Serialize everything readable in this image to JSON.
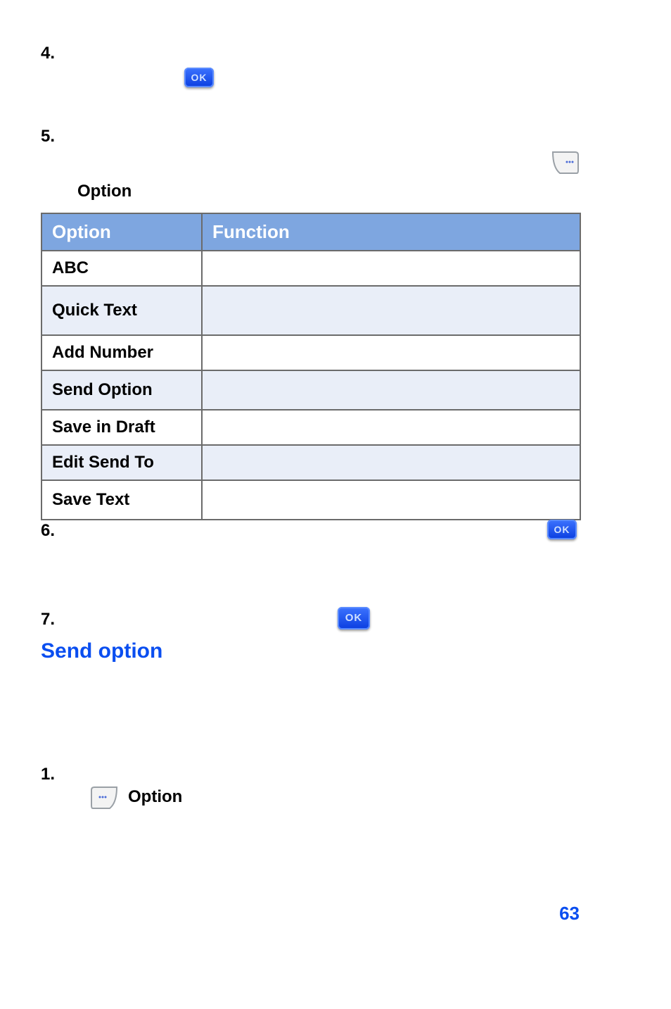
{
  "steps": {
    "s4": "4.",
    "s5": "5.",
    "s6": "6.",
    "s7": "7.",
    "s1": "1."
  },
  "labels": {
    "option_above_table": "Option",
    "option_after_soft": "Option"
  },
  "table": {
    "headers": {
      "c1": "Option",
      "c2": "Function"
    },
    "rows": [
      {
        "opt": "ABC",
        "fn": ""
      },
      {
        "opt": "Quick Text",
        "fn": ""
      },
      {
        "opt": "Add Number",
        "fn": ""
      },
      {
        "opt": "Send Option",
        "fn": ""
      },
      {
        "opt": "Save in Draft",
        "fn": ""
      },
      {
        "opt": "Edit Send To",
        "fn": ""
      },
      {
        "opt": "Save Text",
        "fn": ""
      }
    ]
  },
  "section": {
    "send_option": "Send option"
  },
  "icons": {
    "ok_label": "OK"
  },
  "page_number": "63"
}
